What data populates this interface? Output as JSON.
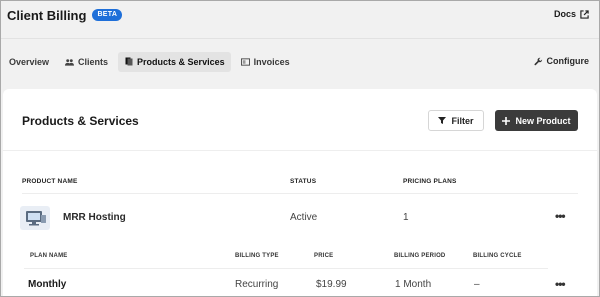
{
  "header": {
    "title": "Client Billing",
    "badge": "BETA",
    "docs_label": "Docs"
  },
  "tabs": [
    {
      "label": "Overview",
      "icon": "none",
      "active": false
    },
    {
      "label": "Clients",
      "icon": "users-icon",
      "active": false
    },
    {
      "label": "Products & Services",
      "icon": "box-icon",
      "active": true
    },
    {
      "label": "Invoices",
      "icon": "invoice-icon",
      "active": false
    }
  ],
  "configure_label": "Configure",
  "card": {
    "title": "Products & Services",
    "filter_label": "Filter",
    "new_label": "New Product"
  },
  "table": {
    "columns": {
      "name": "PRODUCT NAME",
      "status": "STATUS",
      "plans": "PRICING PLANS"
    },
    "rows": [
      {
        "name": "MRR Hosting",
        "status": "Active",
        "plans": "1"
      }
    ]
  },
  "plans_table": {
    "columns": {
      "name": "PLAN NAME",
      "billing_type": "BILLING TYPE",
      "price": "PRICE",
      "billing_period": "BILLING PERIOD",
      "billing_cycle": "BILLING CYCLE"
    },
    "rows": [
      {
        "name": "Monthly",
        "billing_type": "Recurring",
        "price": "$19.99",
        "billing_period": "1 Month",
        "billing_cycle": "–"
      }
    ]
  },
  "colors": {
    "accent": "#1e6fd9",
    "primary_button": "#3b3b3b",
    "background": "#f1f1f1"
  }
}
